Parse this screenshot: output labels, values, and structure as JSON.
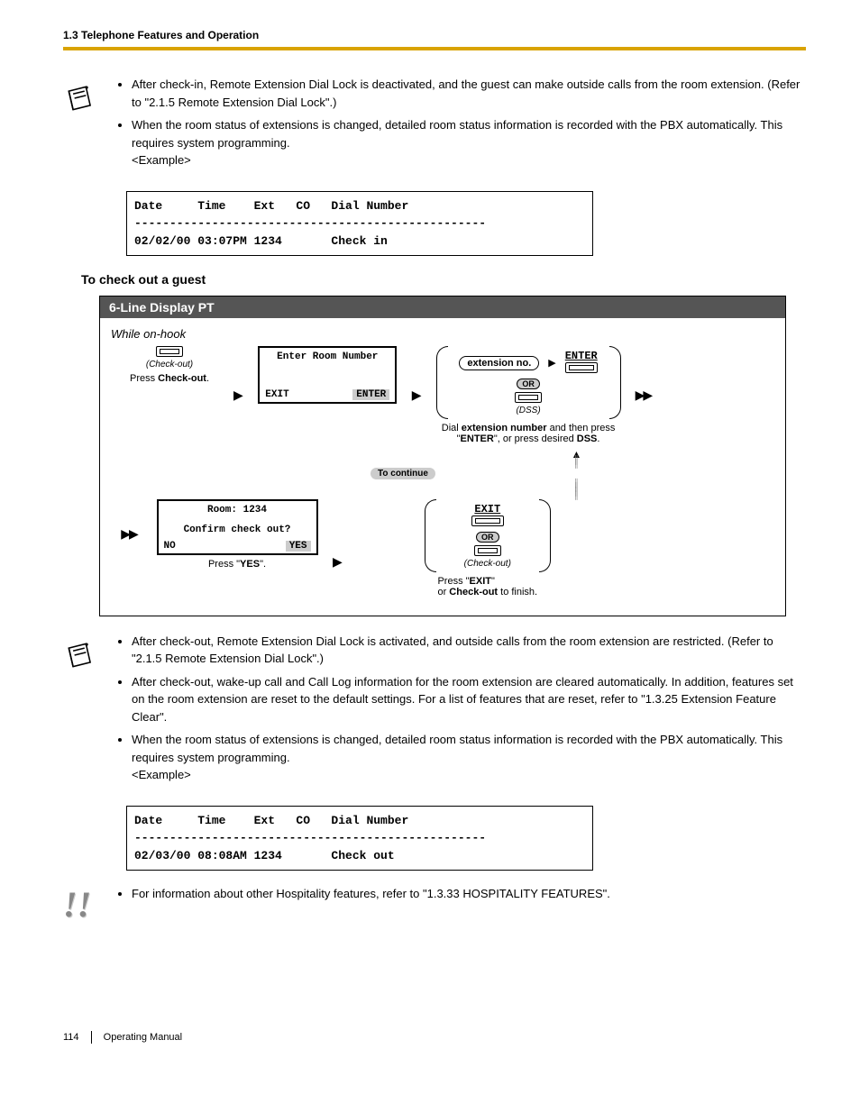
{
  "header": "1.3 Telephone Features and Operation",
  "notes1": {
    "b1": "After check-in, Remote Extension Dial Lock is deactivated, and the guest can make outside calls from the room extension. (Refer to \"2.1.5 Remote Extension Dial Lock\".)",
    "b2": "When the room status of extensions is changed, detailed room status information is recorded with the PBX automatically. This requires system programming.",
    "example_label": "<Example>"
  },
  "example1": "Date     Time    Ext   CO   Dial Number\n--------------------------------------------------\n02/02/00 03:07PM 1234       Check in",
  "subhead": "To check out a guest",
  "flow": {
    "title": "6-Line Display PT",
    "hint": "While on-hook",
    "checkout_lbl": "(Check-out)",
    "press_checkout": "Press Check-out.",
    "scr1_top": "Enter Room Number",
    "scr1_exit": "EXIT",
    "scr1_enter": "ENTER",
    "ext_no": "extension no.",
    "enter": "ENTER",
    "or": "OR",
    "dss": "(DSS)",
    "dial_caption": "Dial extension number and then press \"ENTER\", or press desired DSS.",
    "to_continue": "To continue",
    "scr2_l1": "Room: 1234",
    "scr2_l2": "Confirm check out?",
    "scr2_no": "NO",
    "scr2_yes": "YES",
    "press_yes": "Press \"YES\".",
    "exit": "EXIT",
    "press_exit_l1": "Press \"EXIT\"",
    "press_exit_l2": "or Check-out to finish."
  },
  "notes2": {
    "b1": "After check-out, Remote Extension Dial Lock is activated, and outside calls from the room extension are restricted. (Refer to \"2.1.5 Remote Extension Dial Lock\".)",
    "b2": "After check-out, wake-up call and Call Log information for the room extension are cleared automatically. In addition, features set on the room extension are reset to the default settings. For a list of features that are reset, refer to \"1.3.25 Extension Feature Clear\".",
    "b3": "When the room status of extensions is changed, detailed room status information is recorded with the PBX automatically. This requires system programming.",
    "example_label": "<Example>"
  },
  "example2": "Date     Time    Ext   CO   Dial Number\n--------------------------------------------------\n02/03/00 08:08AM 1234       Check out",
  "notes3": {
    "b1": "For information about other Hospitality features, refer to \"1.3.33 HOSPITALITY FEATURES\"."
  },
  "footer": {
    "page": "114",
    "label": "Operating Manual"
  }
}
